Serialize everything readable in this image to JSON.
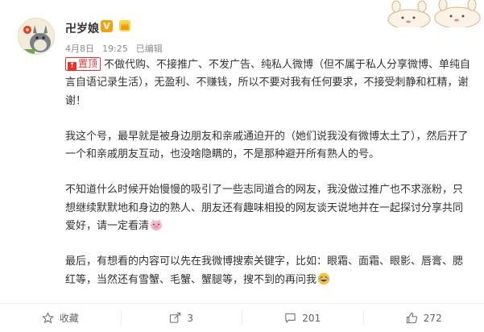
{
  "user": {
    "name": "卍岁娘",
    "vip_mark": "V"
  },
  "meta": {
    "date": "4月8日",
    "time": "19:25",
    "edited": "已编辑"
  },
  "post": {
    "pin_label": "置顶",
    "paragraphs": [
      "不做代购、不接推广、不发广告、纯私人微博（但不属于私人分享微博、单纯自言自语记录生活），无盈利、不赚钱，所以不要对我有任何要求，不接受刺静和杠精，谢谢！",
      "我这个号，最早就是被身边朋友和亲戚通迫开的（她们说我没有微博太土了），然后开了一个和亲戚朋友互动，也没啥隐瞒的，不是那种避开所有熟人的号。",
      "不知道什么时候开始慢慢的吸引了一些志同道合的网友，我没做过推广也不求涨粉，只想继续默默地和身边的熟人、朋友还有趣味相投的网友谈天说地并在一起探讨分享共同爱好，请一定看清",
      "最后，有想看的内容可以先在我微博搜索关键字，比如：眼霜、面霜、眼影、唇膏、腮红等，当然还有雪蟹、毛蟹、蟹腿等，搜不到的再问我"
    ]
  },
  "footer": {
    "collect_label": "收藏",
    "share_count": "3",
    "comment_count": "201",
    "like_count": "272"
  },
  "colors": {
    "pin_red": "#e8322c",
    "vip_orange": "#f2a20a",
    "meta_gray": "#8c8c8c"
  },
  "icons": [
    "avatar-totoro",
    "vip-icon",
    "crown-icon",
    "decor-sticker",
    "pin-icon",
    "pig-emoji",
    "laugh-emoji",
    "star-icon",
    "share-icon",
    "comment-icon",
    "like-icon"
  ]
}
